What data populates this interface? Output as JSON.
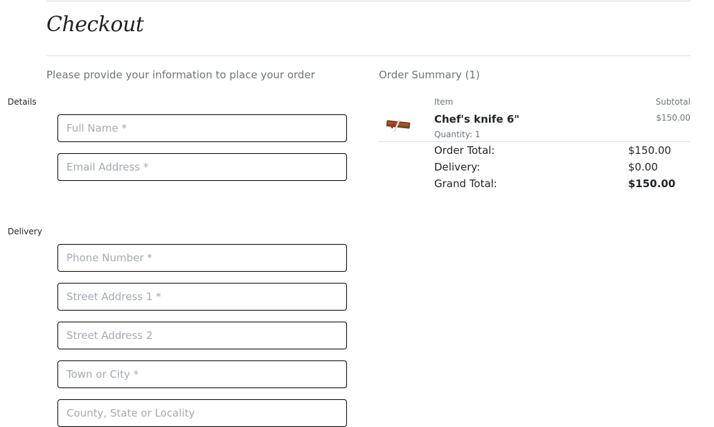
{
  "page": {
    "title": "Checkout",
    "intro": "Please provide your information to place your order"
  },
  "details": {
    "legend": "Details",
    "full_name_placeholder": "Full Name *",
    "email_placeholder": "Email Address *"
  },
  "delivery": {
    "legend": "Delivery",
    "phone_placeholder": "Phone Number *",
    "street1_placeholder": "Street Address 1 *",
    "street2_placeholder": "Street Address 2",
    "town_placeholder": "Town or City *",
    "county_placeholder": "County, State or Locality"
  },
  "summary": {
    "heading": "Order Summary (1)",
    "col_item": "Item",
    "col_subtotal": "Subtotal",
    "items": [
      {
        "name": "Chef's knife 6\"",
        "quantity": "Quantity: 1",
        "subtotal": "$150.00",
        "image": "chef-knife-thumbnail"
      }
    ],
    "order_total_label": "Order Total:",
    "order_total_value": "$150.00",
    "delivery_label": "Delivery:",
    "delivery_value": "$0.00",
    "grand_total_label": "Grand Total:",
    "grand_total_value": "$150.00"
  }
}
